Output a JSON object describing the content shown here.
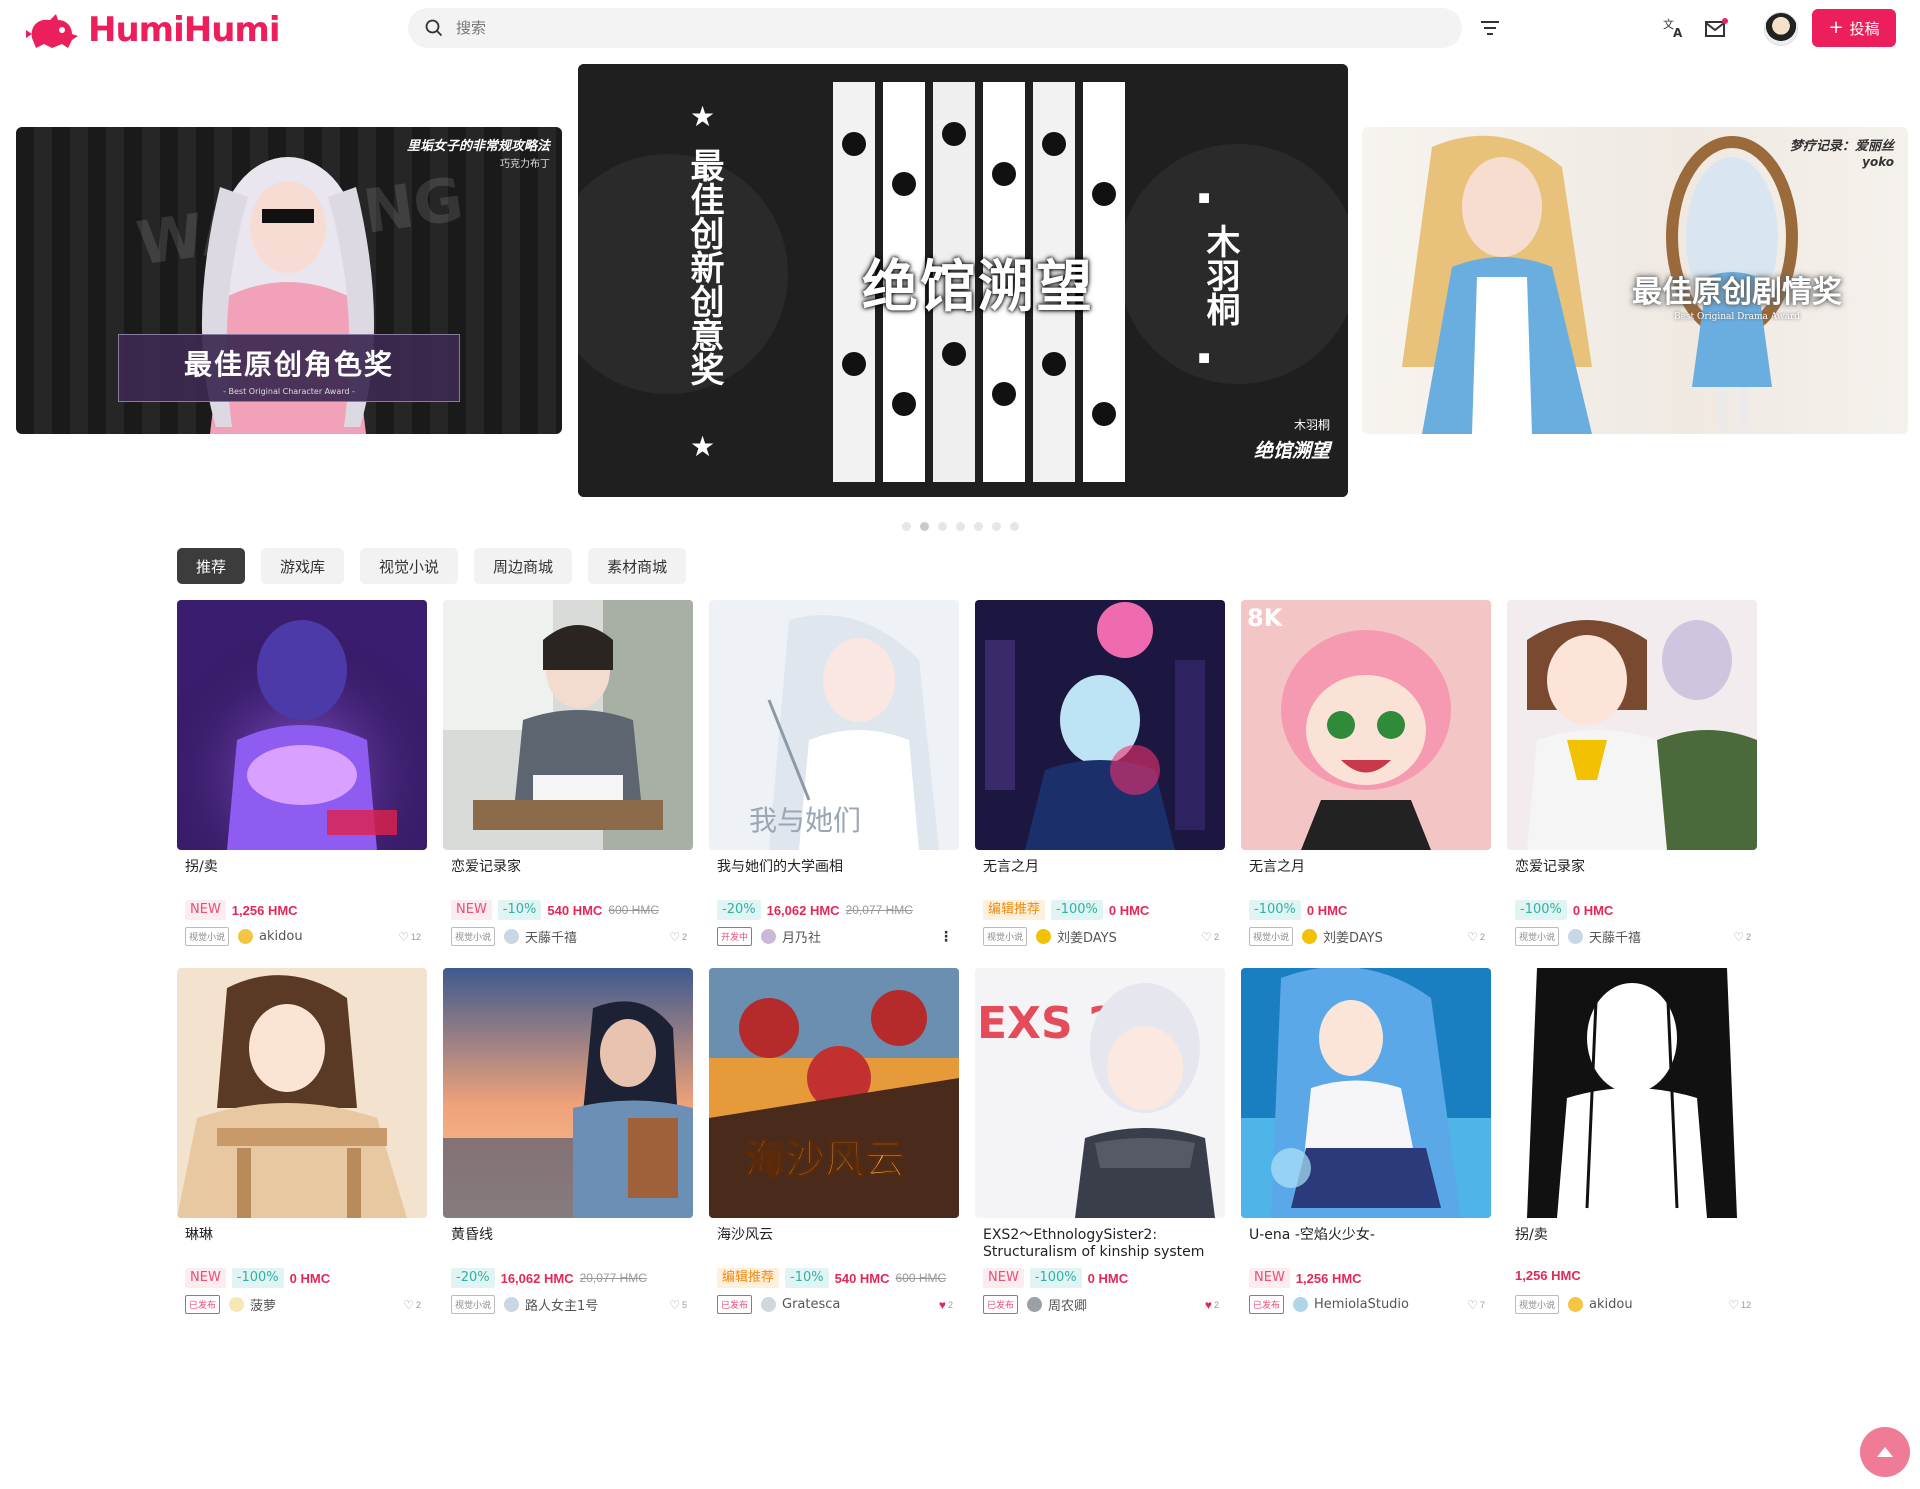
{
  "header": {
    "logo_text": "HumiHumi",
    "search_placeholder": "搜索",
    "submit_label": "投稿",
    "colors": {
      "brand": "#ec1e5c"
    }
  },
  "carousel": {
    "left": {
      "title": "里垢女子的非常规攻略法",
      "author": "巧克力布丁",
      "award": "最佳原创角色奖",
      "award_en": "- Best Original Character Award -",
      "bg_text": "WARNING"
    },
    "center": {
      "award_vertical": "最佳创新创意奖",
      "title_big": "绝馆溯望",
      "author_vertical": "木羽桐",
      "author": "木羽桐",
      "title": "绝馆溯望"
    },
    "right": {
      "title": "梦疗记录：爱丽丝",
      "author": "yoko",
      "award": "最佳原创剧情奖",
      "award_en": "Best Original Drama Award"
    },
    "dot_count": 7,
    "active_dot": 1
  },
  "tabs": [
    {
      "label": "推荐",
      "active": true
    },
    {
      "label": "游戏库",
      "active": false
    },
    {
      "label": "视觉小说",
      "active": false
    },
    {
      "label": "周边商城",
      "active": false
    },
    {
      "label": "素材商城",
      "active": false
    }
  ],
  "cards": [
    {
      "title": "拐/卖",
      "badges": [
        {
          "text": "NEW",
          "kind": "new"
        }
      ],
      "price": "1,256 HMC",
      "old_price": "",
      "tag": "视觉小说",
      "tag_kind": "",
      "user": "akidou",
      "likes": "12",
      "liked": false,
      "more": false,
      "avatar": "#f4c542",
      "thumb": "t1"
    },
    {
      "title": "恋爱记录家",
      "badges": [
        {
          "text": "NEW",
          "kind": "new"
        },
        {
          "text": "-10%",
          "kind": "disc"
        }
      ],
      "price": "540 HMC",
      "old_price": "600 HMC",
      "tag": "视觉小说",
      "tag_kind": "",
      "user": "天藤千禧",
      "likes": "2",
      "liked": false,
      "more": false,
      "avatar": "#c6d7e6",
      "thumb": "t2"
    },
    {
      "title": "我与她们的大学画相",
      "badges": [
        {
          "text": "-20%",
          "kind": "disc"
        }
      ],
      "price": "16,062 HMC",
      "old_price": "20,077 HMC",
      "tag": "开发中",
      "tag_kind": "dev",
      "user": "月乃社",
      "likes": "",
      "liked": false,
      "more": true,
      "avatar": "#cbb7d6",
      "thumb": "t3"
    },
    {
      "title": "无言之月",
      "badges": [
        {
          "text": "编辑推荐",
          "kind": "edit"
        },
        {
          "text": "-100%",
          "kind": "disc"
        }
      ],
      "price": "0 HMC",
      "old_price": "",
      "tag": "视觉小说",
      "tag_kind": "",
      "user": "刘姜DAYS",
      "likes": "2",
      "liked": false,
      "more": false,
      "avatar": "#f2c200",
      "thumb": "t4"
    },
    {
      "title": "无言之月",
      "badges": [
        {
          "text": "-100%",
          "kind": "disc"
        }
      ],
      "price": "0 HMC",
      "old_price": "",
      "tag": "视觉小说",
      "tag_kind": "",
      "user": "刘姜DAYS",
      "likes": "2",
      "liked": false,
      "more": false,
      "avatar": "#f2c200",
      "thumb": "t5"
    },
    {
      "title": "恋爱记录家",
      "badges": [
        {
          "text": "-100%",
          "kind": "disc"
        }
      ],
      "price": "0 HMC",
      "old_price": "",
      "tag": "视觉小说",
      "tag_kind": "",
      "user": "天藤千禧",
      "likes": "2",
      "liked": false,
      "more": false,
      "avatar": "#c6d7e6",
      "thumb": "t6"
    },
    {
      "title": "琳琳",
      "badges": [
        {
          "text": "NEW",
          "kind": "new"
        },
        {
          "text": "-100%",
          "kind": "disc"
        }
      ],
      "price": "0 HMC",
      "old_price": "",
      "tag": "已发布",
      "tag_kind": "pub",
      "user": "菠萝",
      "likes": "2",
      "liked": false,
      "more": false,
      "avatar": "#f7e7b6",
      "thumb": "t7"
    },
    {
      "title": "黄昏线",
      "badges": [
        {
          "text": "-20%",
          "kind": "disc"
        }
      ],
      "price": "16,062 HMC",
      "old_price": "20,077 HMC",
      "tag": "视觉小说",
      "tag_kind": "",
      "user": "路人女主1号",
      "likes": "5",
      "liked": false,
      "more": false,
      "avatar": "#c6d7e6",
      "thumb": "t8"
    },
    {
      "title": "海沙风云",
      "badges": [
        {
          "text": "编辑推荐",
          "kind": "edit"
        },
        {
          "text": "-10%",
          "kind": "disc"
        }
      ],
      "price": "540 HMC",
      "old_price": "600 HMC",
      "tag": "已发布",
      "tag_kind": "pub",
      "user": "Gratesca",
      "likes": "2",
      "liked": true,
      "more": false,
      "avatar": "#cfd8dc",
      "thumb": "t9"
    },
    {
      "title": "EXS2～EthnologySister2: Structuralism of kinship system",
      "badges": [
        {
          "text": "NEW",
          "kind": "new"
        },
        {
          "text": "-100%",
          "kind": "disc"
        }
      ],
      "price": "0 HMC",
      "old_price": "",
      "tag": "已发布",
      "tag_kind": "pub",
      "user": "周农卿",
      "likes": "2",
      "liked": true,
      "more": false,
      "avatar": "#9aa0a6",
      "thumb": "t10"
    },
    {
      "title": "U-ena -空焰火少女-",
      "badges": [
        {
          "text": "NEW",
          "kind": "new"
        }
      ],
      "price": "1,256 HMC",
      "old_price": "",
      "tag": "已发布",
      "tag_kind": "pub",
      "user": "HemiolaStudio",
      "likes": "7",
      "liked": false,
      "more": false,
      "avatar": "#b0d4e8",
      "thumb": "t11"
    },
    {
      "title": "拐/卖",
      "badges": [],
      "price": "1,256 HMC",
      "old_price": "",
      "tag": "视觉小说",
      "tag_kind": "",
      "user": "akidou",
      "likes": "12",
      "liked": false,
      "more": false,
      "avatar": "#f4c542",
      "thumb": "t12"
    }
  ]
}
